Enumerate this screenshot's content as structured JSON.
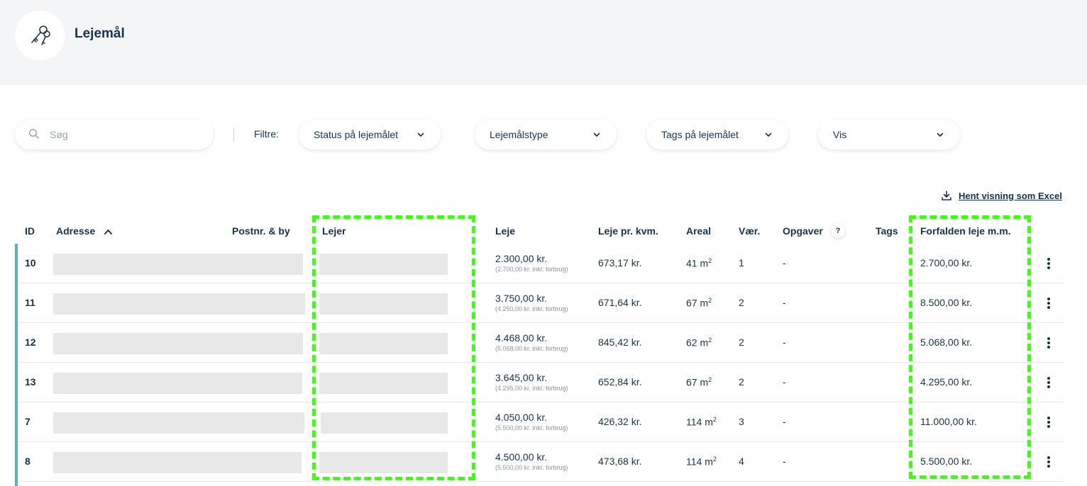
{
  "header": {
    "title": "Lejemål",
    "icon": "keys-icon"
  },
  "toolbar": {
    "search_placeholder": "Søg",
    "filter_label": "Filtre:",
    "filters": [
      {
        "label": "Status på lejemålet"
      },
      {
        "label": "Lejemålstype"
      },
      {
        "label": "Tags på lejemålet"
      },
      {
        "label": "Vis"
      }
    ],
    "export_label": "Hent visning som Excel"
  },
  "table": {
    "columns": {
      "id": "ID",
      "adresse": "Adresse",
      "postnr": "Postnr. & by",
      "lejer": "Lejer",
      "leje": "Leje",
      "leje_kvm": "Leje pr. kvm.",
      "areal": "Areal",
      "vaer": "Vær.",
      "opgaver": "Opgaver",
      "opgaver_help": "?",
      "tags": "Tags",
      "forfalden": "Forfalden leje m.m."
    },
    "sort": {
      "column": "Adresse",
      "direction": "ascending"
    },
    "area_unit": "m",
    "area_exp": "2",
    "rows": [
      {
        "id": "10",
        "leje": "2.300,00 kr.",
        "leje_incl": "(2.700,00 kr. inkl. forbrug)",
        "kvm": "673,17 kr.",
        "areal": "41",
        "vaer": "1",
        "opgaver": "-",
        "forfalden": "2.700,00 kr."
      },
      {
        "id": "11",
        "leje": "3.750,00 kr.",
        "leje_incl": "(4.250,00 kr. inkl. forbrug)",
        "kvm": "671,64 kr.",
        "areal": "67",
        "vaer": "2",
        "opgaver": "-",
        "forfalden": "8.500,00 kr."
      },
      {
        "id": "12",
        "leje": "4.468,00 kr.",
        "leje_incl": "(5.068,00 kr. inkl. forbrug)",
        "kvm": "845,42 kr.",
        "areal": "62",
        "vaer": "2",
        "opgaver": "-",
        "forfalden": "5.068,00 kr."
      },
      {
        "id": "13",
        "leje": "3.645,00 kr.",
        "leje_incl": "(4.295,00 kr. inkl. forbrug)",
        "kvm": "652,84 kr.",
        "areal": "67",
        "vaer": "2",
        "opgaver": "-",
        "forfalden": "4.295,00 kr."
      },
      {
        "id": "7",
        "leje": "4.050,00 kr.",
        "leje_incl": "(5.500,00 kr. inkl. forbrug)",
        "kvm": "426,32 kr.",
        "areal": "114",
        "vaer": "3",
        "opgaver": "-",
        "forfalden": "11.000,00 kr."
      },
      {
        "id": "8",
        "leje": "4.500,00 kr.",
        "leje_incl": "(5.500,00 kr. inkl. forbrug)",
        "kvm": "473,68 kr.",
        "areal": "114",
        "vaer": "4",
        "opgaver": "-",
        "forfalden": "5.500,00 kr."
      }
    ]
  },
  "colors": {
    "accent": "#58b7bd",
    "highlight": "#3cff14",
    "text": "#17324d",
    "header_bg": "#f4f5f7",
    "redaction": "#e8e8e8"
  }
}
